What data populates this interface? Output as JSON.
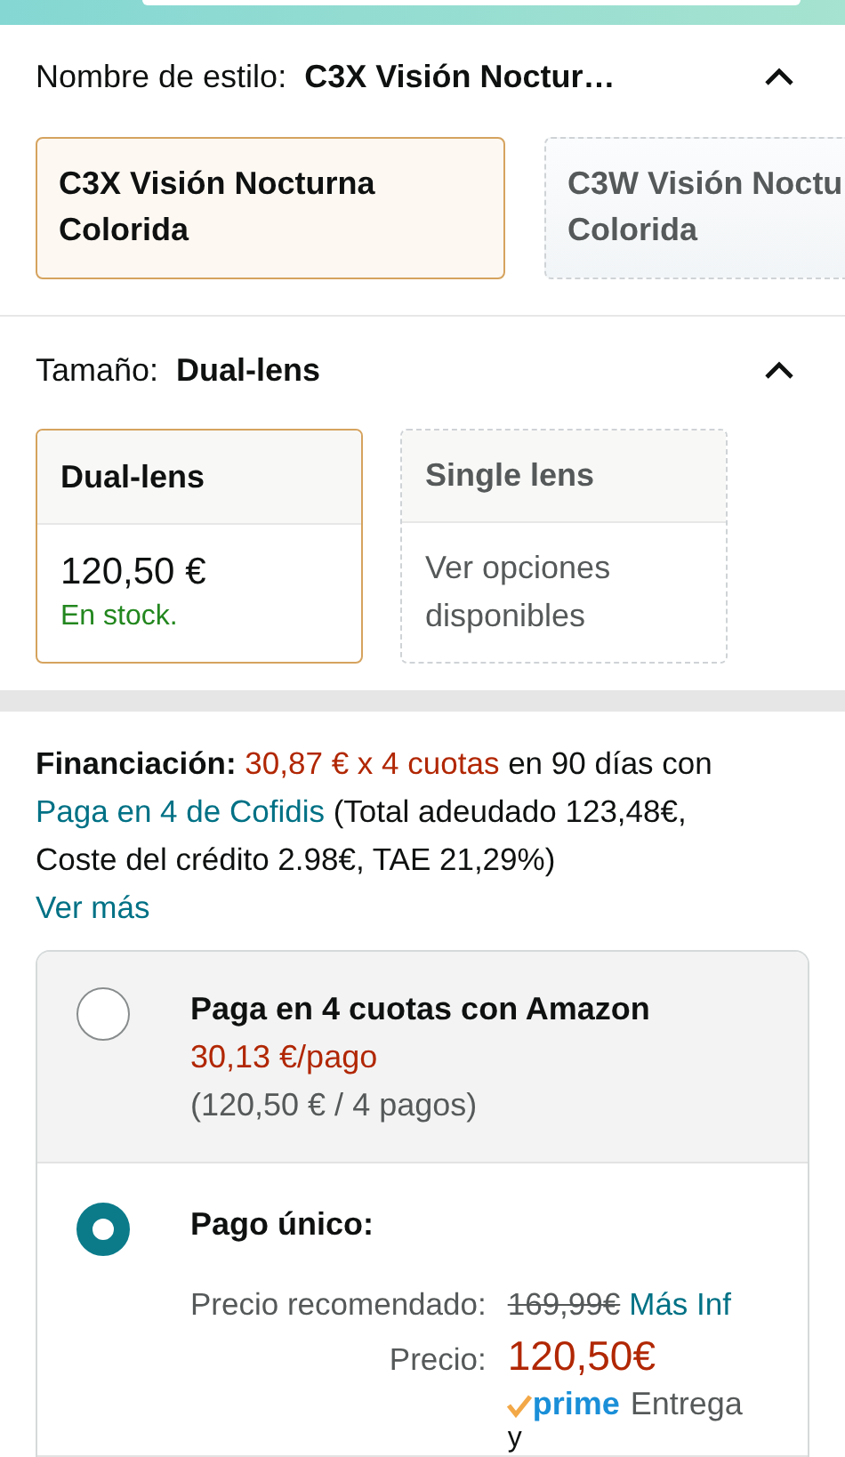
{
  "style_selector": {
    "label": "Nombre de estilo:",
    "value": "C3X Visión Noctur…",
    "expanded": true,
    "options": [
      {
        "lines": [
          "C3X Visión Nocturna",
          "Colorida"
        ],
        "selected": true
      },
      {
        "lines": [
          "C3W Visión Noctu",
          "Colorida"
        ],
        "selected": false
      }
    ]
  },
  "size_selector": {
    "label": "Tamaño:",
    "value": "Dual-lens",
    "expanded": true,
    "options": [
      {
        "name": "Dual-lens",
        "selected": true,
        "price": "120,50 €",
        "availability": "En stock."
      },
      {
        "name": "Single lens",
        "selected": false,
        "note": "Ver opciones disponibles"
      }
    ]
  },
  "financing": {
    "segments": [
      {
        "kind": "label",
        "text": "Financiación:"
      },
      {
        "kind": "highlight",
        "text": "30,87 € x 4 cuotas"
      },
      {
        "kind": "plain",
        "text": "en 90 días con"
      },
      {
        "kind": "link",
        "text": "Paga en 4 de Cofidis"
      },
      {
        "kind": "plain",
        "text": "(Total adeudado 123,48€, Coste del crédito 2.98€, TAE 21,29%)"
      }
    ],
    "more_link": "Ver más"
  },
  "payment_options": [
    {
      "kind": "installments",
      "selected": false,
      "title": "Paga en 4 cuotas con Amazon",
      "per_payment": "30,13 €/pago",
      "detail": "(120,50 € / 4 pagos)"
    },
    {
      "kind": "single",
      "selected": true,
      "title": "Pago único:",
      "list_price_label": "Precio recomendado:",
      "list_price": "169,99€",
      "more_link": "Más Inf",
      "price_label": "Precio:",
      "price": "120,50€",
      "prime_badge": "prime",
      "delivery": "Entrega",
      "continuation": "y"
    }
  ]
}
